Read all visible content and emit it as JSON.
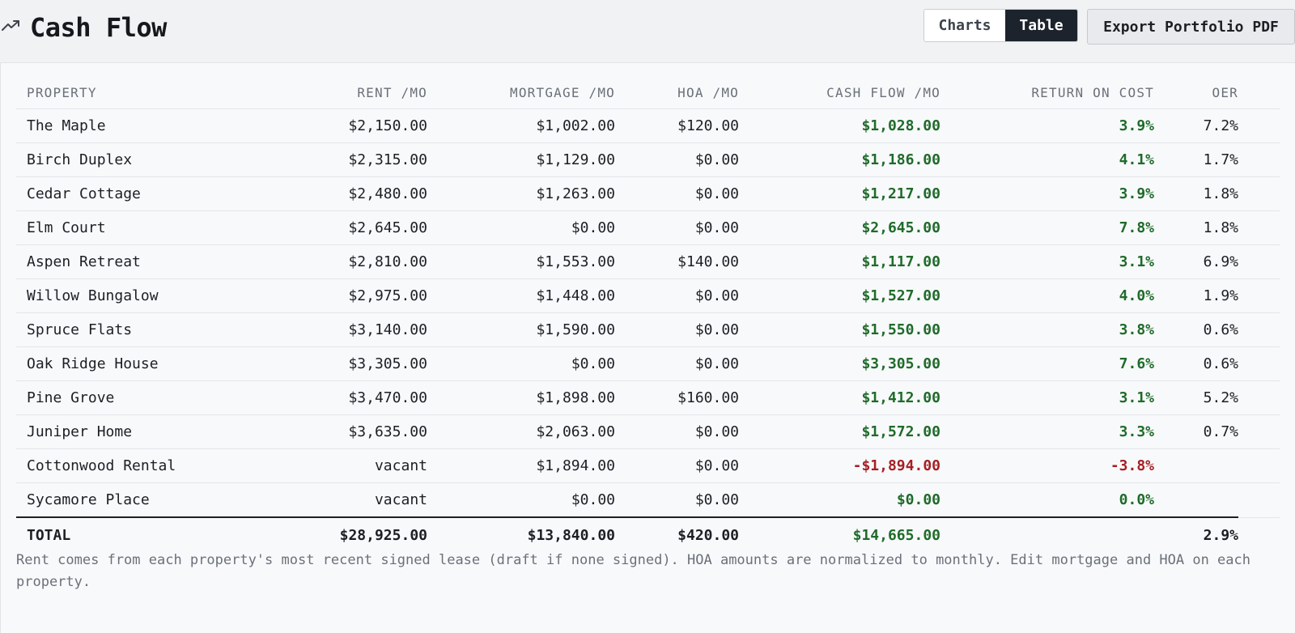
{
  "header": {
    "title": "Cash Flow",
    "icon": "trending-up-icon",
    "view_toggle": {
      "options": [
        "Charts",
        "Table"
      ],
      "selected": "Table"
    },
    "export_label": "Export Portfolio PDF"
  },
  "table": {
    "columns": [
      "PROPERTY",
      "RENT /MO",
      "MORTGAGE /MO",
      "HOA /MO",
      "CASH FLOW /MO",
      "RETURN ON COST",
      "OER"
    ],
    "rows": [
      {
        "property": "The Maple",
        "rent": "$2,150.00",
        "mortgage": "$1,002.00",
        "hoa": "$120.00",
        "cash_flow": "$1,028.00",
        "return_on_cost": "3.9%",
        "oer": "7.2%",
        "sign": "pos"
      },
      {
        "property": "Birch Duplex",
        "rent": "$2,315.00",
        "mortgage": "$1,129.00",
        "hoa": "$0.00",
        "cash_flow": "$1,186.00",
        "return_on_cost": "4.1%",
        "oer": "1.7%",
        "sign": "pos"
      },
      {
        "property": "Cedar Cottage",
        "rent": "$2,480.00",
        "mortgage": "$1,263.00",
        "hoa": "$0.00",
        "cash_flow": "$1,217.00",
        "return_on_cost": "3.9%",
        "oer": "1.8%",
        "sign": "pos"
      },
      {
        "property": "Elm Court",
        "rent": "$2,645.00",
        "mortgage": "$0.00",
        "hoa": "$0.00",
        "cash_flow": "$2,645.00",
        "return_on_cost": "7.8%",
        "oer": "1.8%",
        "sign": "pos"
      },
      {
        "property": "Aspen Retreat",
        "rent": "$2,810.00",
        "mortgage": "$1,553.00",
        "hoa": "$140.00",
        "cash_flow": "$1,117.00",
        "return_on_cost": "3.1%",
        "oer": "6.9%",
        "sign": "pos"
      },
      {
        "property": "Willow Bungalow",
        "rent": "$2,975.00",
        "mortgage": "$1,448.00",
        "hoa": "$0.00",
        "cash_flow": "$1,527.00",
        "return_on_cost": "4.0%",
        "oer": "1.9%",
        "sign": "pos"
      },
      {
        "property": "Spruce Flats",
        "rent": "$3,140.00",
        "mortgage": "$1,590.00",
        "hoa": "$0.00",
        "cash_flow": "$1,550.00",
        "return_on_cost": "3.8%",
        "oer": "0.6%",
        "sign": "pos"
      },
      {
        "property": "Oak Ridge House",
        "rent": "$3,305.00",
        "mortgage": "$0.00",
        "hoa": "$0.00",
        "cash_flow": "$3,305.00",
        "return_on_cost": "7.6%",
        "oer": "0.6%",
        "sign": "pos"
      },
      {
        "property": "Pine Grove",
        "rent": "$3,470.00",
        "mortgage": "$1,898.00",
        "hoa": "$160.00",
        "cash_flow": "$1,412.00",
        "return_on_cost": "3.1%",
        "oer": "5.2%",
        "sign": "pos"
      },
      {
        "property": "Juniper Home",
        "rent": "$3,635.00",
        "mortgage": "$2,063.00",
        "hoa": "$0.00",
        "cash_flow": "$1,572.00",
        "return_on_cost": "3.3%",
        "oer": "0.7%",
        "sign": "pos"
      },
      {
        "property": "Cottonwood Rental",
        "rent": "vacant",
        "mortgage": "$1,894.00",
        "hoa": "$0.00",
        "cash_flow": "-$1,894.00",
        "return_on_cost": "-3.8%",
        "oer": "",
        "sign": "neg"
      },
      {
        "property": "Sycamore Place",
        "rent": "vacant",
        "mortgage": "$0.00",
        "hoa": "$0.00",
        "cash_flow": "$0.00",
        "return_on_cost": "0.0%",
        "oer": "",
        "sign": "pos"
      }
    ],
    "total": {
      "label": "TOTAL",
      "rent": "$28,925.00",
      "mortgage": "$13,840.00",
      "hoa": "$420.00",
      "cash_flow": "$14,665.00",
      "return_on_cost": "",
      "oer": "2.9%"
    }
  },
  "footnote": "Rent comes from each property's most recent signed lease (draft if none signed). HOA amounts are normalized to monthly. Edit mortgage and HOA on each property.",
  "colors": {
    "positive": "#1f6b2a",
    "negative": "#a61f24",
    "toggle_active_bg": "#1c232c"
  }
}
